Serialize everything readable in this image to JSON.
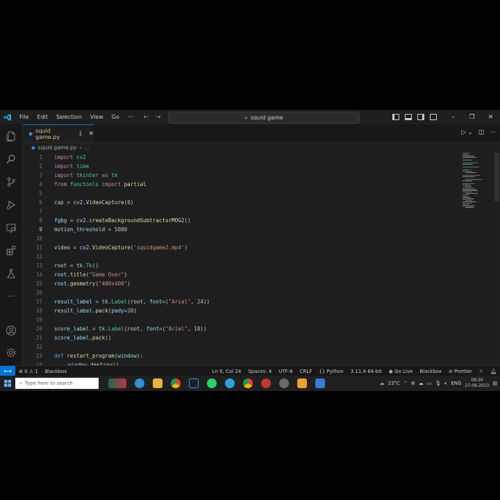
{
  "menu": {
    "file": "File",
    "edit": "Edit",
    "selection": "Selection",
    "view": "View",
    "go": "Go",
    "more": "···"
  },
  "search": {
    "label": "squid game"
  },
  "tab": {
    "label": "squid game.py",
    "modified_count": "1"
  },
  "breadcrumb": {
    "file": "squid game.py",
    "more": "..."
  },
  "code": [
    {
      "n": "1"
    },
    {
      "n": "2"
    },
    {
      "n": "3"
    },
    {
      "n": "4"
    },
    {
      "n": "5"
    },
    {
      "n": "6"
    },
    {
      "n": "7"
    },
    {
      "n": "8"
    },
    {
      "n": "9"
    },
    {
      "n": "10"
    },
    {
      "n": "11"
    },
    {
      "n": "12"
    },
    {
      "n": "13"
    },
    {
      "n": "14"
    },
    {
      "n": "15"
    },
    {
      "n": "16"
    },
    {
      "n": "17"
    },
    {
      "n": "18"
    },
    {
      "n": "19"
    },
    {
      "n": "20"
    },
    {
      "n": "21"
    },
    {
      "n": "22"
    },
    {
      "n": "23"
    },
    {
      "n": "24"
    }
  ],
  "code_text": {
    "l1": [
      "import",
      "cv2"
    ],
    "l2": [
      "import",
      "time"
    ],
    "l3": [
      "import",
      "tkinter",
      "as",
      "tk"
    ],
    "l4": [
      "from",
      "functools",
      "import",
      "partial"
    ],
    "l6": [
      "cap",
      "=",
      "cv2",
      ".",
      "VideoCapture",
      "(",
      "0",
      ")"
    ],
    "l8": [
      "fgbg",
      "=",
      "cv2",
      ".",
      "createBackgroundSubtractorMOG2",
      "()"
    ],
    "l9": [
      "motion_threshold",
      "=",
      "5000"
    ],
    "l11": [
      "video",
      "=",
      "cv2",
      ".",
      "VideoCapture",
      "(",
      "'squidgame2.mp4'",
      ")"
    ],
    "l13": [
      "root",
      "=",
      "tk",
      ".",
      "Tk",
      "()"
    ],
    "l14": [
      "root",
      ".",
      "title",
      "(",
      "\"Game Over\"",
      ")"
    ],
    "l15": [
      "root",
      ".",
      "geometry",
      "(",
      "\"400x400\"",
      ")"
    ],
    "l17": [
      "result_label",
      "=",
      "tk",
      ".",
      "Label",
      "(root, ",
      "font",
      "=(",
      "\"Arial\"",
      ", ",
      "24",
      "))"
    ],
    "l18": [
      "result_label",
      ".",
      "pack",
      "(",
      "pady",
      "=",
      "20",
      ")"
    ],
    "l20": [
      "score_label",
      "=",
      "tk",
      ".",
      "Label",
      "(root, ",
      "font",
      "=(",
      "\"Arial\"",
      ", ",
      "18",
      "))"
    ],
    "l21": [
      "score_label",
      ".",
      "pack",
      "()"
    ],
    "l23": [
      "def",
      "restart_program",
      "(",
      "window",
      "):"
    ],
    "l24": [
      "window",
      ".",
      "destroy",
      "()"
    ]
  },
  "active_line": "9",
  "status": {
    "errors": "0",
    "warnings": "1",
    "blackbox_left": "Blackbox",
    "position": "Ln 9, Col 24",
    "spaces": "Spaces: 4",
    "encoding": "UTF-8",
    "eol": "CRLF",
    "language": "Python",
    "interpreter": "3.11.4 64-bit",
    "golive": "Go Live",
    "blackbox_right": "Blackbox",
    "prettier": "Prettier"
  },
  "taskbar": {
    "search_placeholder": "Type here to search",
    "weather": "23°C",
    "lang": "ENG",
    "time": "09:20",
    "date": "27-06-2023"
  },
  "colors": {
    "accent": "#0078d4",
    "keyword": "#c586c0",
    "function": "#dcdcaa",
    "string": "#ce9178",
    "number": "#b5cea8",
    "variable": "#9cdcfe"
  }
}
